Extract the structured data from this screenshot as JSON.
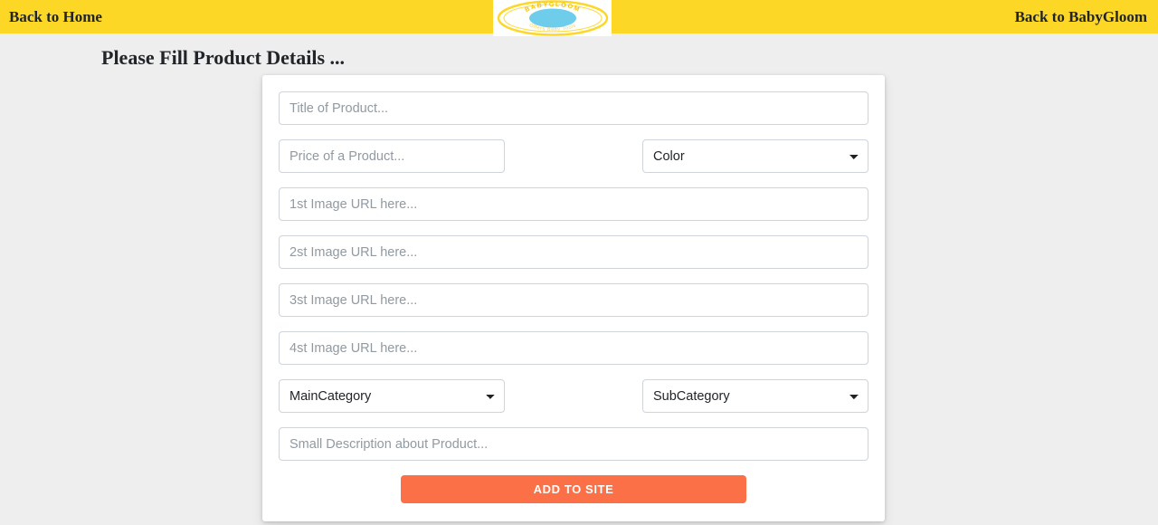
{
  "header": {
    "back_home_label": "Back to Home",
    "back_site_label": "Back to BabyGloom",
    "background_color": "#fdd726",
    "logo": {
      "icon": "babygloom-oval-logo",
      "brand_text": "BABYGLOOM",
      "tagline_text": "Offers Baby Tools",
      "ring_color": "#fdd726",
      "center_color": "#6ecdeb"
    }
  },
  "page": {
    "heading": "Please Fill Product Details ..."
  },
  "form": {
    "title_placeholder": "Title of Product...",
    "price_placeholder": "Price of a Product...",
    "color_select": {
      "selected": "Color",
      "icon": "chevron-down-icon"
    },
    "image1_placeholder": "1st Image URL here...",
    "image2_placeholder": "2st Image URL here...",
    "image3_placeholder": "3st Image URL here...",
    "image4_placeholder": "4st Image URL here...",
    "main_category_select": {
      "selected": "MainCategory",
      "icon": "chevron-down-icon"
    },
    "sub_category_select": {
      "selected": "SubCategory",
      "icon": "chevron-down-icon"
    },
    "description_placeholder": "Small Description about Product...",
    "submit_label": "ADD TO SITE",
    "submit_color": "#fb7046"
  }
}
